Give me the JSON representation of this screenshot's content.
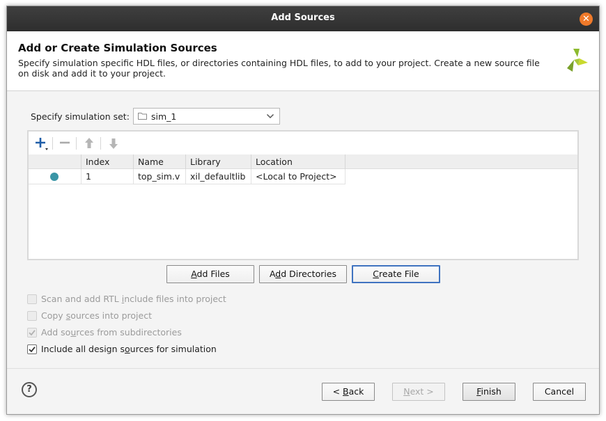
{
  "window": {
    "title": "Add Sources"
  },
  "header": {
    "title": "Add or Create Simulation Sources",
    "description": "Specify simulation specific HDL files, or directories containing HDL files, to add to your project. Create a new source file on disk and add it to your project."
  },
  "simulation_set": {
    "label": "Specify simulation set:",
    "value": "sim_1",
    "icon": "folder-icon"
  },
  "toolbar": {
    "icons": [
      "add-icon",
      "remove-icon",
      "move-up-icon",
      "move-down-icon"
    ]
  },
  "table": {
    "columns": [
      "",
      "Index",
      "Name",
      "Library",
      "Location"
    ],
    "rows": [
      {
        "index": "1",
        "name": "top_sim.v",
        "library": "xil_defaultlib",
        "location": "<Local to Project>"
      }
    ]
  },
  "actions": {
    "add_files": {
      "pre": "",
      "key": "A",
      "post": "dd Files"
    },
    "add_directories": {
      "pre": "A",
      "key": "d",
      "post": "d Directories"
    },
    "create_file": {
      "pre": "",
      "key": "C",
      "post": "reate File"
    }
  },
  "options": [
    {
      "pre": "Scan and add RTL ",
      "key": "i",
      "post": "nclude files into project",
      "checked": false,
      "enabled": false
    },
    {
      "pre": "Copy ",
      "key": "s",
      "post": "ources into project",
      "checked": false,
      "enabled": false
    },
    {
      "pre": "Add so",
      "key": "u",
      "post": "rces from subdirectories",
      "checked": true,
      "enabled": false
    },
    {
      "pre": "Include all design s",
      "key": "o",
      "post": "urces for simulation",
      "checked": true,
      "enabled": true
    }
  ],
  "footer": {
    "help": "?",
    "back": {
      "pre": "< ",
      "key": "B",
      "post": "ack"
    },
    "next": {
      "pre": "",
      "key": "N",
      "post": "ext >"
    },
    "finish": {
      "pre": "",
      "key": "F",
      "post": "inish"
    },
    "cancel": "Cancel"
  },
  "colors": {
    "accent": "#3f73c0",
    "close": "#f07a2a",
    "status_dot": "#3a95a6",
    "logo": "#8cba2e"
  }
}
